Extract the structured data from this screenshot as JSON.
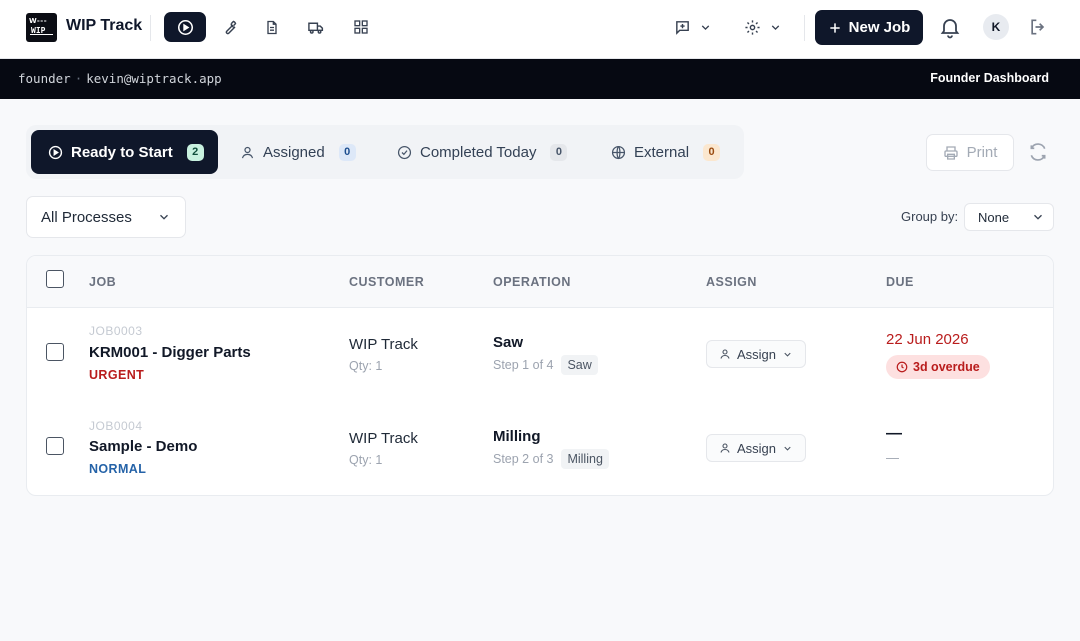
{
  "app": {
    "logo_line1": "W---",
    "logo_line2": "WIP",
    "name": "WIP Track"
  },
  "header": {
    "new_job_label": "New Job",
    "avatar_initial": "K"
  },
  "userbar": {
    "role": "founder",
    "separator": "·",
    "email": "kevin@wiptrack.app",
    "dashboard_label": "Founder Dashboard"
  },
  "tabs": [
    {
      "label": "Ready to Start",
      "count": "2",
      "icon": "play-circle-icon"
    },
    {
      "label": "Assigned",
      "count": "0",
      "icon": "user-icon"
    },
    {
      "label": "Completed Today",
      "count": "0",
      "icon": "check-circle-icon"
    },
    {
      "label": "External",
      "count": "0",
      "icon": "globe-icon"
    }
  ],
  "toolbar": {
    "print_label": "Print"
  },
  "filters": {
    "process_value": "All Processes",
    "group_by_label": "Group by:",
    "group_by_value": "None"
  },
  "table": {
    "columns": [
      "JOB",
      "CUSTOMER",
      "OPERATION",
      "ASSIGN",
      "DUE"
    ],
    "assign_label": "Assign",
    "rows": [
      {
        "job_id": "JOB0003",
        "job_name": "KRM001 - Digger Parts",
        "priority": "URGENT",
        "customer": "WIP Track",
        "qty": "Qty: 1",
        "operation": "Saw",
        "step": "Step 1 of 4",
        "process_chip": "Saw",
        "due_date": "22 Jun 2026",
        "overdue": "3d overdue"
      },
      {
        "job_id": "JOB0004",
        "job_name": "Sample - Demo",
        "priority": "NORMAL",
        "customer": "WIP Track",
        "qty": "Qty: 1",
        "operation": "Milling",
        "step": "Step 2 of 3",
        "process_chip": "Milling",
        "due_primary": "—",
        "due_secondary": "—"
      }
    ]
  },
  "colors": {
    "primary": "#0f172a",
    "urgent": "#b91c1c",
    "normal": "#2563a8",
    "overdue_bg": "#fde0e0"
  }
}
